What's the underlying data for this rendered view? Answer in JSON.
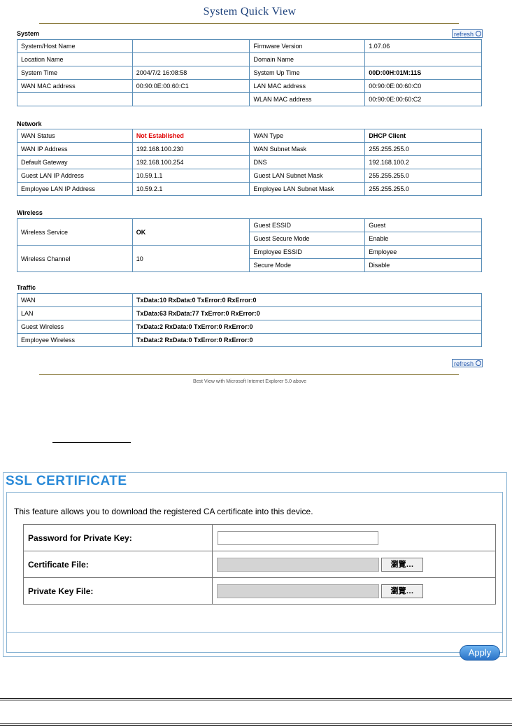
{
  "quick_view": {
    "title": "System Quick View",
    "refresh_label": "refresh",
    "system": {
      "label": "System",
      "rows": [
        [
          "System/Host Name",
          "",
          "Firmware Version",
          "1.07.06"
        ],
        [
          "Location Name",
          "",
          "Domain Name",
          ""
        ],
        [
          "System Time",
          "2004/7/2 16:08:58",
          "System Up Time",
          "00D:00H:01M:11S"
        ],
        [
          "WAN MAC address",
          "00:90:0E:00:60:C1",
          "LAN MAC address",
          "00:90:0E:00:60:C0"
        ],
        [
          "",
          "",
          "WLAN MAC address",
          "00:90:0E:00:60:C2"
        ]
      ]
    },
    "network": {
      "label": "Network",
      "rows": [
        [
          "WAN Status",
          "Not Established",
          "WAN Type",
          "DHCP Client"
        ],
        [
          "WAN IP Address",
          "192.168.100.230",
          "WAN Subnet Mask",
          "255.255.255.0"
        ],
        [
          "Default Gateway",
          "192.168.100.254",
          "DNS",
          "192.168.100.2"
        ],
        [
          "Guest LAN IP Address",
          "10.59.1.1",
          "Guest LAN Subnet Mask",
          "255.255.255.0"
        ],
        [
          "Employee LAN IP Address",
          "10.59.2.1",
          "Employee LAN Subnet Mask",
          "255.255.255.0"
        ]
      ]
    },
    "wireless": {
      "label": "Wireless",
      "service_label": "Wireless Service",
      "service_value": "OK",
      "channel_label": "Wireless Channel",
      "channel_value": "10",
      "pairs": [
        [
          "Guest ESSID",
          "Guest"
        ],
        [
          "Guest Secure Mode",
          "Enable"
        ],
        [
          "Employee ESSID",
          "Employee"
        ],
        [
          "Secure Mode",
          "Disable"
        ]
      ]
    },
    "traffic": {
      "label": "Traffic",
      "rows": [
        [
          "WAN",
          "TxData:10 RxData:0 TxError:0 RxError:0"
        ],
        [
          "LAN",
          "TxData:63 RxData:77 TxError:0 RxError:0"
        ],
        [
          "Guest Wireless",
          "TxData:2 RxData:0 TxError:0 RxError:0"
        ],
        [
          "Employee Wireless",
          "TxData:2 RxData:0 TxError:0 RxError:0"
        ]
      ]
    },
    "footer": "Best View with Microsoft Internet Explorer 5.0 above"
  },
  "ssl": {
    "title": "SSL CERTIFICATE",
    "description": "This feature allows you to download the registered CA certificate into this device.",
    "password_label": "Password for Private Key:",
    "password_value": "",
    "cert_label": "Certificate File:",
    "key_label": "Private Key File:",
    "browse_label": "瀏覽…",
    "apply_label": "Apply"
  }
}
